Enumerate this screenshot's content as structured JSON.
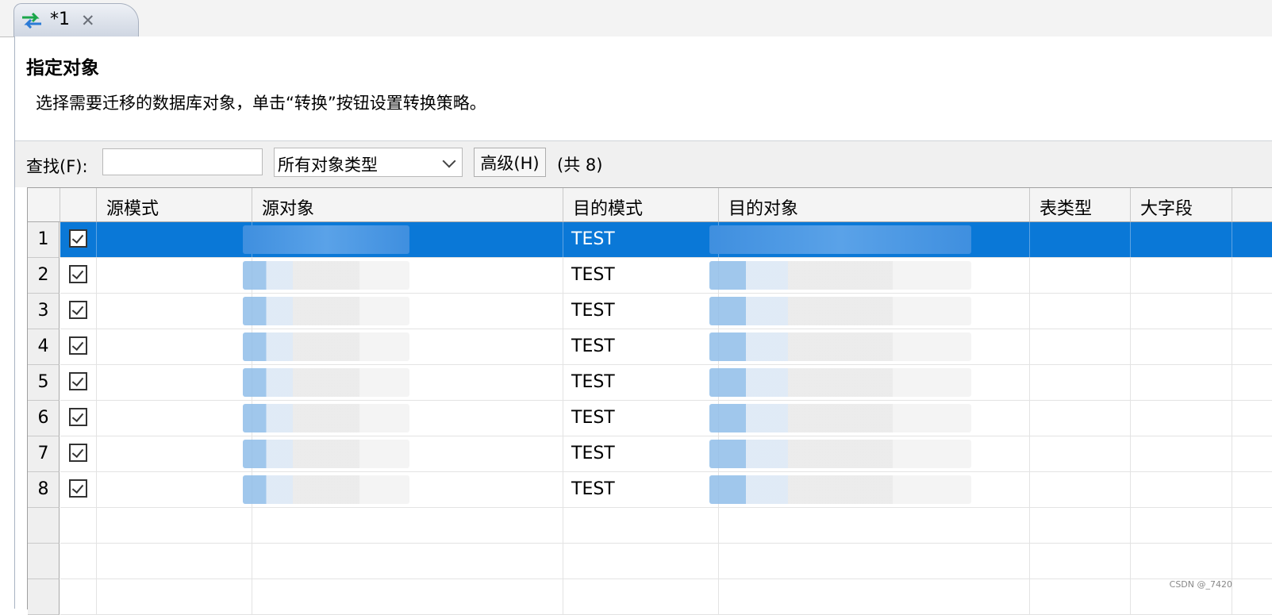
{
  "tab": {
    "title": "*1",
    "close_glyph": "✕",
    "icon": "transfer-arrows-icon"
  },
  "header": {
    "title": "指定对象",
    "description": "选择需要迁移的数据库对象，单击“转换”按钮设置转换策略。"
  },
  "toolbar": {
    "find_label": "查找(F):",
    "find_value": "",
    "object_type": "所有对象类型",
    "advanced_label": "高级(H)",
    "count_label": "(共 8)"
  },
  "table": {
    "columns": [
      "源模式",
      "源对象",
      "目的模式",
      "目的对象",
      "表类型",
      "大字段"
    ],
    "rows": [
      {
        "num": "1",
        "checked": true,
        "dest_schema": "TEST",
        "selected": true
      },
      {
        "num": "2",
        "checked": true,
        "dest_schema": "TEST"
      },
      {
        "num": "3",
        "checked": true,
        "dest_schema": "TEST"
      },
      {
        "num": "4",
        "checked": true,
        "dest_schema": "TEST"
      },
      {
        "num": "5",
        "checked": true,
        "dest_schema": "TEST"
      },
      {
        "num": "6",
        "checked": true,
        "dest_schema": "TEST"
      },
      {
        "num": "7",
        "checked": true,
        "dest_schema": "TEST"
      },
      {
        "num": "8",
        "checked": true,
        "dest_schema": "TEST"
      }
    ]
  },
  "watermark": "CSDN @_7420",
  "colors": {
    "selection": "#0a78d7"
  }
}
